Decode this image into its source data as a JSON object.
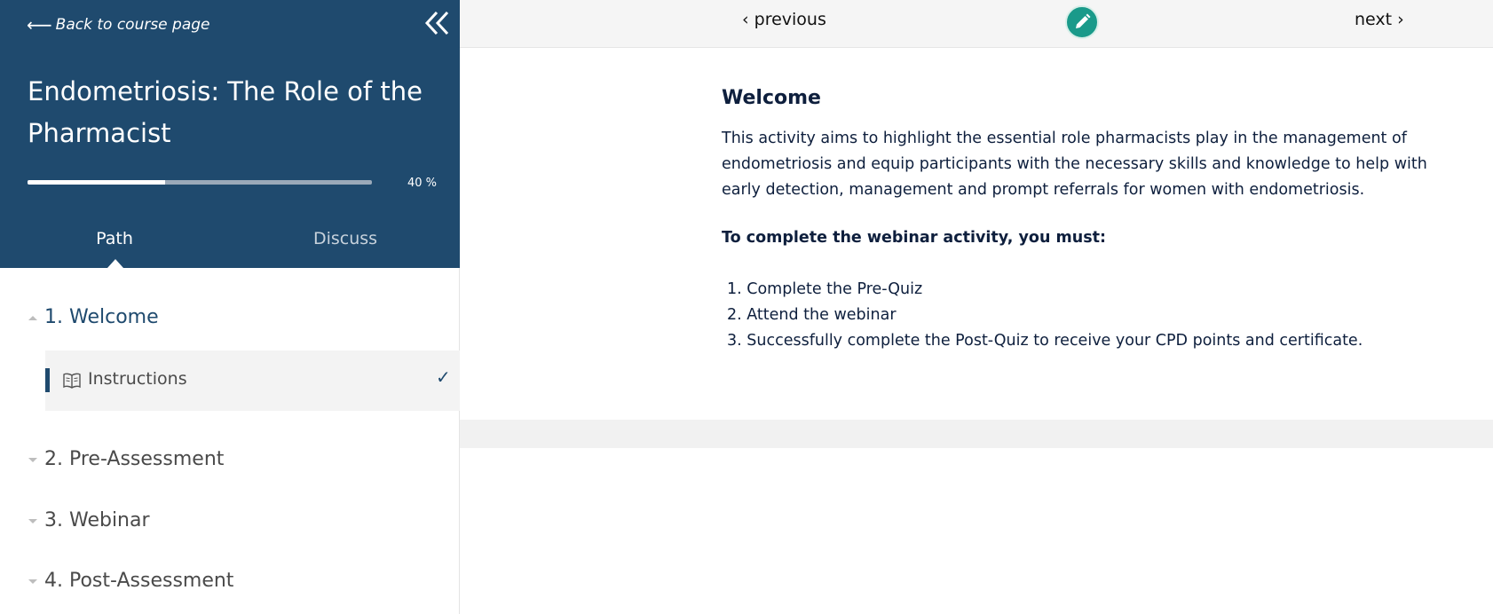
{
  "sidebar": {
    "back_link": "Back to course page",
    "course_title": "Endometriosis: The Role of the Pharmacist",
    "progress": {
      "percent": 40,
      "label": "40 %"
    },
    "tabs": [
      {
        "label": "Path",
        "active": true
      },
      {
        "label": "Discuss",
        "active": false
      }
    ],
    "sections": [
      {
        "label": "1. Welcome",
        "expanded": true,
        "items": [
          {
            "label": "Instructions",
            "completed": true,
            "icon": "book-icon"
          }
        ]
      },
      {
        "label": "2. Pre-Assessment",
        "expanded": false
      },
      {
        "label": "3. Webinar",
        "expanded": false
      },
      {
        "label": "4. Post-Assessment",
        "expanded": false
      }
    ]
  },
  "topbar": {
    "previous_label": "previous",
    "next_label": "next",
    "edit_icon": "pencil-icon"
  },
  "content": {
    "title": "Welcome",
    "intro": "This activity aims to highlight the essential role pharmacists play in the management of endometriosis and equip participants with the necessary skills and knowledge to help with early detection, management and prompt referrals for women with endometriosis.",
    "requirements_heading": "To complete the webinar activity, you must:",
    "steps": [
      "1. Complete the Pre-Quiz",
      "2. Attend the webinar",
      "3. Successfully complete the Post-Quiz to receive your CPD points and certificate."
    ]
  },
  "colors": {
    "sidebar_header": "#1f4a6e",
    "accent": "#1f4a6e",
    "edit_button": "#1a9a8a",
    "text": "#0e1f3d"
  }
}
